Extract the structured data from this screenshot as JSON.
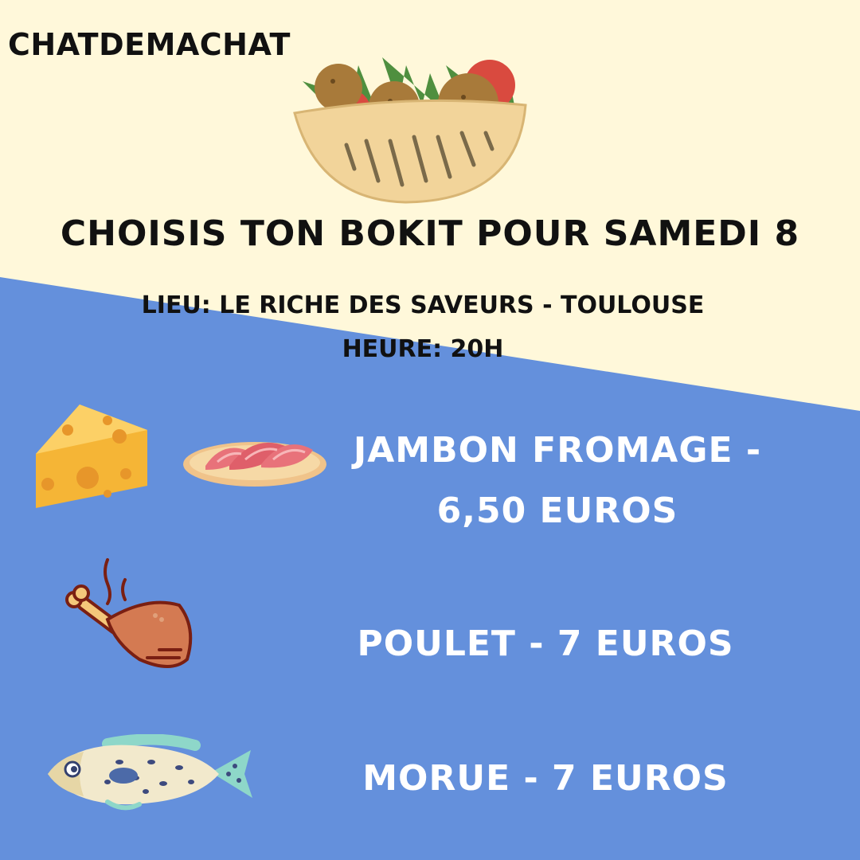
{
  "brand": "CHATDEMACHAT",
  "headline": "CHOISIS TON BOKIT POUR SAMEDI 8",
  "info": {
    "lieu": "LIEU: LE RICHE DES SAVEURS - TOULOUSE",
    "heure": "HEURE: 20H"
  },
  "menu": [
    {
      "label": "JAMBON FROMAGE - 6,50 EUROS",
      "icon": "cheese-and-ham-icon"
    },
    {
      "label": "POULET - 7 EUROS",
      "icon": "chicken-leg-icon"
    },
    {
      "label": "MORUE - 7 EUROS",
      "icon": "fish-icon"
    }
  ],
  "colors": {
    "cream": "#fff8da",
    "blue": "#6490dc",
    "text_dark": "#111111",
    "text_light": "#ffffff"
  }
}
